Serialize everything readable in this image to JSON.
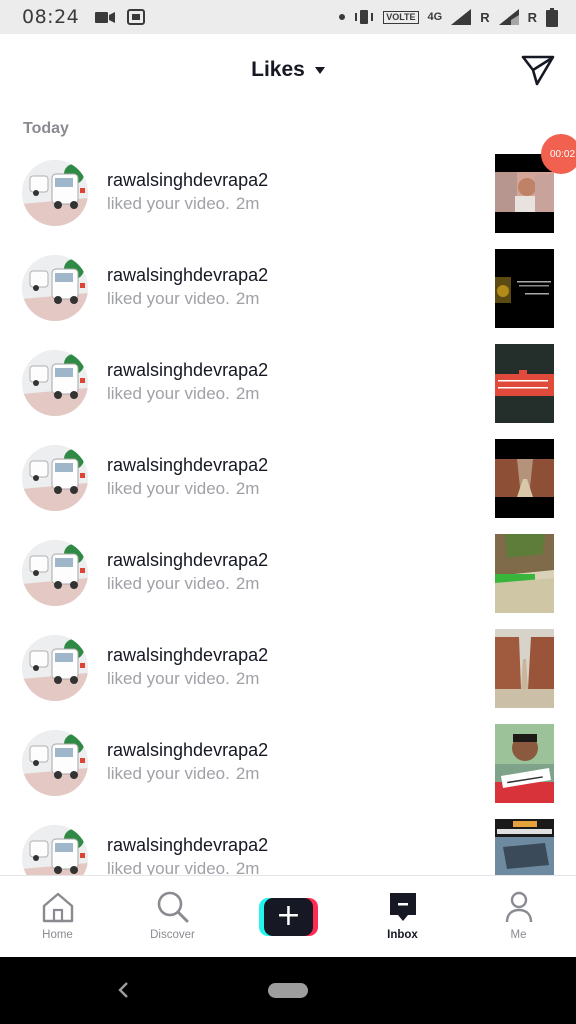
{
  "status_bar": {
    "time": "08:24",
    "volte": "VOLTE",
    "network": "4G",
    "sim1": "R",
    "sim2": "R"
  },
  "header": {
    "title": "Likes"
  },
  "section": "Today",
  "timer_badge": "00:02",
  "notifications": [
    {
      "username": "rawalsinghdevrapa2",
      "text": "liked your video.",
      "time": "2m"
    },
    {
      "username": "rawalsinghdevrapa2",
      "text": "liked your video.",
      "time": "2m"
    },
    {
      "username": "rawalsinghdevrapa2",
      "text": "liked your video.",
      "time": "2m"
    },
    {
      "username": "rawalsinghdevrapa2",
      "text": "liked your video.",
      "time": "2m"
    },
    {
      "username": "rawalsinghdevrapa2",
      "text": "liked your video.",
      "time": "2m"
    },
    {
      "username": "rawalsinghdevrapa2",
      "text": "liked your video.",
      "time": "2m"
    },
    {
      "username": "rawalsinghdevrapa2",
      "text": "liked your video.",
      "time": "2m"
    },
    {
      "username": "rawalsinghdevrapa2",
      "text": "liked your video.",
      "time": "2m"
    }
  ],
  "bottom_nav": {
    "home": "Home",
    "discover": "Discover",
    "create": "+",
    "inbox": "Inbox",
    "me": "Me"
  },
  "colors": {
    "accent_red": "#fe2c55",
    "accent_cyan": "#25f4ee",
    "timer_badge": "#f2614f"
  }
}
